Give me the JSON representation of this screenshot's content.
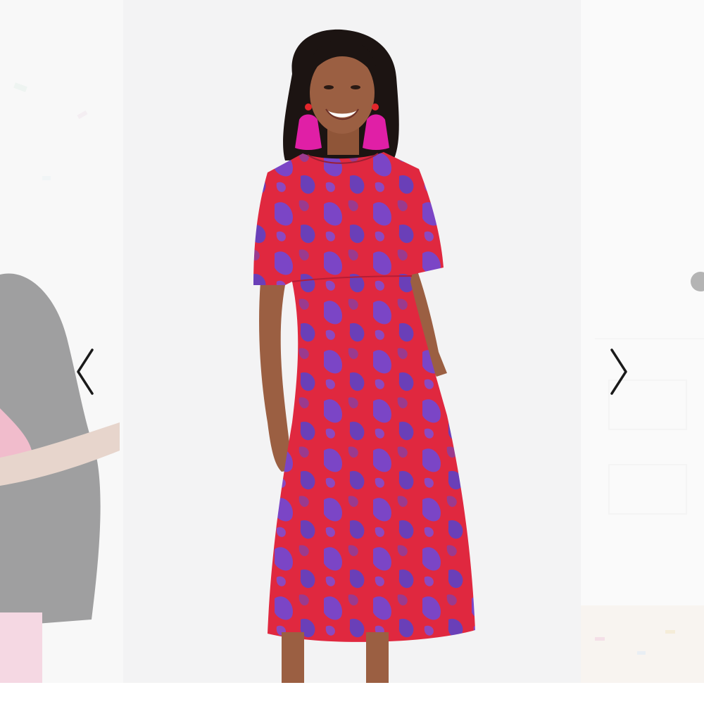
{
  "carousel": {
    "prev_slide": {
      "description_icon": "partial-photo-person-black-velvet-dress"
    },
    "main_slide": {
      "description_icon": "product-photo-red-purple-jacquard-midi-dress"
    },
    "next_slide": {
      "description_icon": "partial-photo-room-with-confetti"
    },
    "prev_icon": "chevron-left-icon",
    "next_icon": "chevron-right-icon"
  },
  "colors": {
    "dress_red": "#e0283f",
    "dress_purple": "#7b45c6",
    "earring_pink": "#e01fa6",
    "skin": "#9b5f42",
    "hair": "#1c1412",
    "background": "#f3f3f4"
  }
}
